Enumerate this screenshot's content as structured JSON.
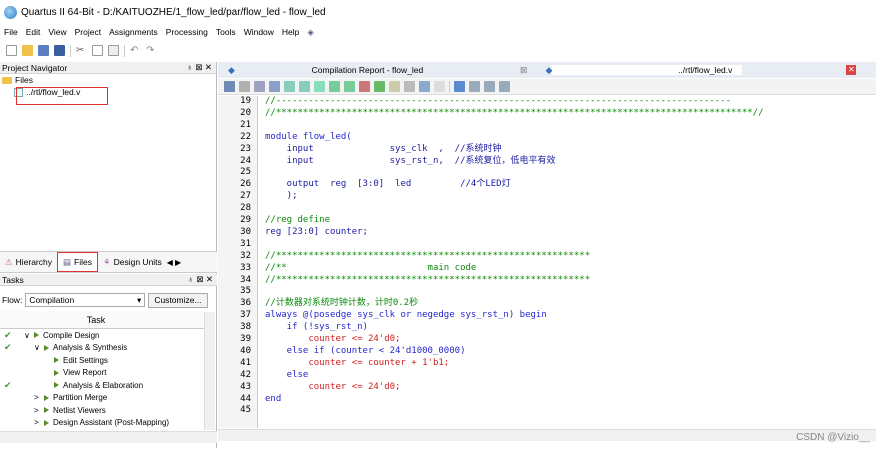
{
  "window": {
    "title": "Quartus II 64-Bit - D:/KAITUOZHE/1_flow_led/par/flow_led - flow_led"
  },
  "menu": [
    "File",
    "Edit",
    "View",
    "Project",
    "Assignments",
    "Processing",
    "Tools",
    "Window",
    "Help"
  ],
  "project_navigator": {
    "title": "Project Navigator",
    "files_folder": "Files",
    "file": "../rtl/flow_led.v"
  },
  "nav_tabs": [
    "Hierarchy",
    "Files",
    "Design Units"
  ],
  "tasks": {
    "title": "Tasks",
    "flow_label": "Flow:",
    "flow_value": "Compilation",
    "customize": "Customize...",
    "column": "Task",
    "rows": [
      {
        "label": "Compile Design",
        "checked": true,
        "indent": 1,
        "expand": "∨"
      },
      {
        "label": "Analysis & Synthesis",
        "checked": true,
        "indent": 2,
        "expand": "∨"
      },
      {
        "label": "Edit Settings",
        "checked": false,
        "indent": 3,
        "expand": ""
      },
      {
        "label": "View Report",
        "checked": false,
        "indent": 3,
        "expand": ""
      },
      {
        "label": "Analysis & Elaboration",
        "checked": true,
        "indent": 3,
        "expand": ""
      },
      {
        "label": "Partition Merge",
        "checked": false,
        "indent": 2,
        "expand": ">"
      },
      {
        "label": "Netlist Viewers",
        "checked": false,
        "indent": 2,
        "expand": ">"
      },
      {
        "label": "Design Assistant (Post-Mapping)",
        "checked": false,
        "indent": 2,
        "expand": ">"
      }
    ]
  },
  "editor_tabs": {
    "compilation_report": "Compilation Report - flow_led",
    "file": "../rtl/flow_led.v"
  },
  "code_lines": [
    {
      "n": "19",
      "t": "//------------------------------------------------------------------------------------",
      "c": "com"
    },
    {
      "n": "20",
      "t": "//****************************************************************************************//",
      "c": "com"
    },
    {
      "n": "21",
      "t": "",
      "c": ""
    },
    {
      "n": "22",
      "t": "module flow_led(",
      "c": "kw"
    },
    {
      "n": "23",
      "t": "    input              sys_clk  ,  //系统时钟",
      "c": "mix"
    },
    {
      "n": "24",
      "t": "    input              sys_rst_n,  //系统复位，低电平有效",
      "c": "mix"
    },
    {
      "n": "25",
      "t": "",
      "c": ""
    },
    {
      "n": "26",
      "t": "    output  reg  [3:0]  led         //4个LED灯",
      "c": "mix"
    },
    {
      "n": "27",
      "t": "    );",
      "c": ""
    },
    {
      "n": "28",
      "t": "",
      "c": ""
    },
    {
      "n": "29",
      "t": "//reg define",
      "c": "com"
    },
    {
      "n": "30",
      "t": "reg [23:0] counter;",
      "c": "mix"
    },
    {
      "n": "31",
      "t": "",
      "c": ""
    },
    {
      "n": "32",
      "t": "//**********************************************************",
      "c": "com"
    },
    {
      "n": "33",
      "t": "//**                          main code",
      "c": "com"
    },
    {
      "n": "34",
      "t": "//**********************************************************",
      "c": "com"
    },
    {
      "n": "35",
      "t": "",
      "c": ""
    },
    {
      "n": "36",
      "t": "//计数器对系统时钟计数，计时0.2秒",
      "c": "com"
    },
    {
      "n": "37",
      "t": "always @(posedge sys_clk or negedge sys_rst_n) begin",
      "c": "kw"
    },
    {
      "n": "38",
      "t": "    if (!sys_rst_n)",
      "c": "kw"
    },
    {
      "n": "39",
      "t": "        counter <= 24'd0;",
      "c": "num"
    },
    {
      "n": "40",
      "t": "    else if (counter < 24'd1000_0000)",
      "c": "kw"
    },
    {
      "n": "41",
      "t": "        counter <= counter + 1'b1;",
      "c": "num"
    },
    {
      "n": "42",
      "t": "    else",
      "c": "kw"
    },
    {
      "n": "43",
      "t": "        counter <= 24'd0;",
      "c": "num"
    },
    {
      "n": "44",
      "t": "end",
      "c": "kw"
    },
    {
      "n": "45",
      "t": "",
      "c": ""
    }
  ],
  "watermark": "CSDN @Vizio__",
  "colors": {
    "highlight": "#e03030",
    "comment": "#0a8a0a",
    "keyword": "#2626d0",
    "number": "#d02020"
  }
}
